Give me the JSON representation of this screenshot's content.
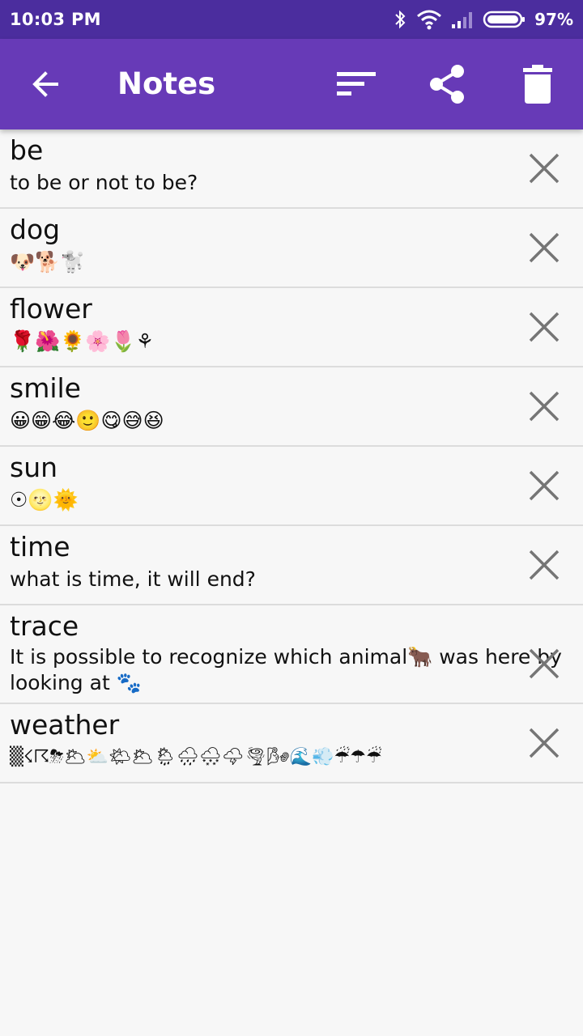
{
  "status_bar": {
    "time": "10:03 PM",
    "battery_percent": "97%"
  },
  "app_bar": {
    "title": "Notes",
    "icons": [
      "back-arrow-icon",
      "sort-icon",
      "share-icon",
      "trash-icon"
    ]
  },
  "notes": [
    {
      "title": "be",
      "body": "to be or not to be?"
    },
    {
      "title": "dog",
      "body": "🐶🐕🐩"
    },
    {
      "title": "flower",
      "body": "🌹🌺🌻🌸🌷⚘"
    },
    {
      "title": "smile",
      "body": "😀😁😂🙂😋😅😆"
    },
    {
      "title": "sun",
      "body": "☉🌝🌞"
    },
    {
      "title": "time",
      "body": "what is time, it will end?"
    },
    {
      "title": "trace",
      "body": "It is possible to recognize which animal🐂 was here by looking at 🐾"
    },
    {
      "title": "weather",
      "body": "▒☇☈⛈🌥⛅🌤🌥🌦🌧🌨🌩🌪🌬🌊💨☔☂☔"
    }
  ],
  "colors": {
    "status_bar": "#4b2d9e",
    "app_bar": "#673ab7",
    "background": "#f7f7f7",
    "divider": "#dcdcdc",
    "delete_x": "#757575"
  }
}
